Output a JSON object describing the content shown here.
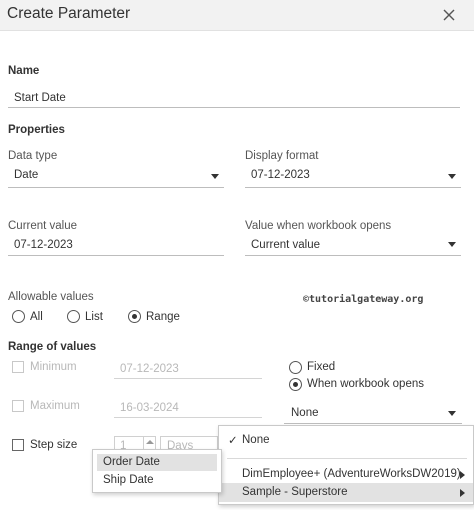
{
  "dialog": {
    "title": "Create Parameter",
    "close_icon": "close-icon"
  },
  "name": {
    "section": "Name",
    "value": "Start Date"
  },
  "properties": {
    "section": "Properties",
    "data_type_label": "Data type",
    "data_type_value": "Date",
    "display_format_label": "Display format",
    "display_format_value": "07-12-2023",
    "current_value_label": "Current value",
    "current_value_value": "07-12-2023",
    "workbook_opens_label": "Value when workbook opens",
    "workbook_opens_value": "Current value"
  },
  "allowable": {
    "label": "Allowable values",
    "options": [
      "All",
      "List",
      "Range"
    ],
    "selected": "Range"
  },
  "watermark": "©tutorialgateway.org",
  "range": {
    "section": "Range of values",
    "minimum_label": "Minimum",
    "minimum_value": "07-12-2023",
    "maximum_label": "Maximum",
    "maximum_value": "16-03-2024",
    "step_label": "Step size",
    "step_value": "1",
    "step_unit": "Days",
    "fixed_label": "Fixed",
    "when_opens_label": "When workbook opens",
    "when_opens_dropdown": "None"
  },
  "source_menu": {
    "items": [
      {
        "label": "None",
        "checked": true
      },
      {
        "label": "DimEmployee+ (AdventureWorksDW2019)",
        "submenu": true
      },
      {
        "label": "Sample - Superstore",
        "submenu": true,
        "highlighted": true
      }
    ]
  },
  "field_menu": {
    "items": [
      "Order Date",
      "Ship Date"
    ],
    "highlighted": "Order Date"
  },
  "colors": {
    "titlebar": "#f2f2f2",
    "highlight": "#e2e2e2",
    "text": "#333333"
  }
}
